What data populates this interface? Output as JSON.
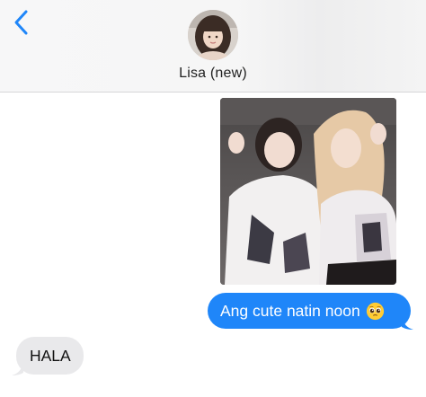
{
  "header": {
    "contact_name": "Lisa (new)",
    "back_icon": "chevron-left-icon"
  },
  "messages": [
    {
      "direction": "outgoing",
      "type": "image",
      "description_icon": "photo-attachment"
    },
    {
      "direction": "outgoing",
      "type": "text",
      "text": "Ang cute natin noon",
      "emoji": "pleading-face"
    },
    {
      "direction": "incoming",
      "type": "text",
      "text": "HALA"
    }
  ],
  "colors": {
    "accent": "#1f86f9",
    "incoming_bubble": "#e9e9eb",
    "header_bg": "#f7f7f8"
  }
}
